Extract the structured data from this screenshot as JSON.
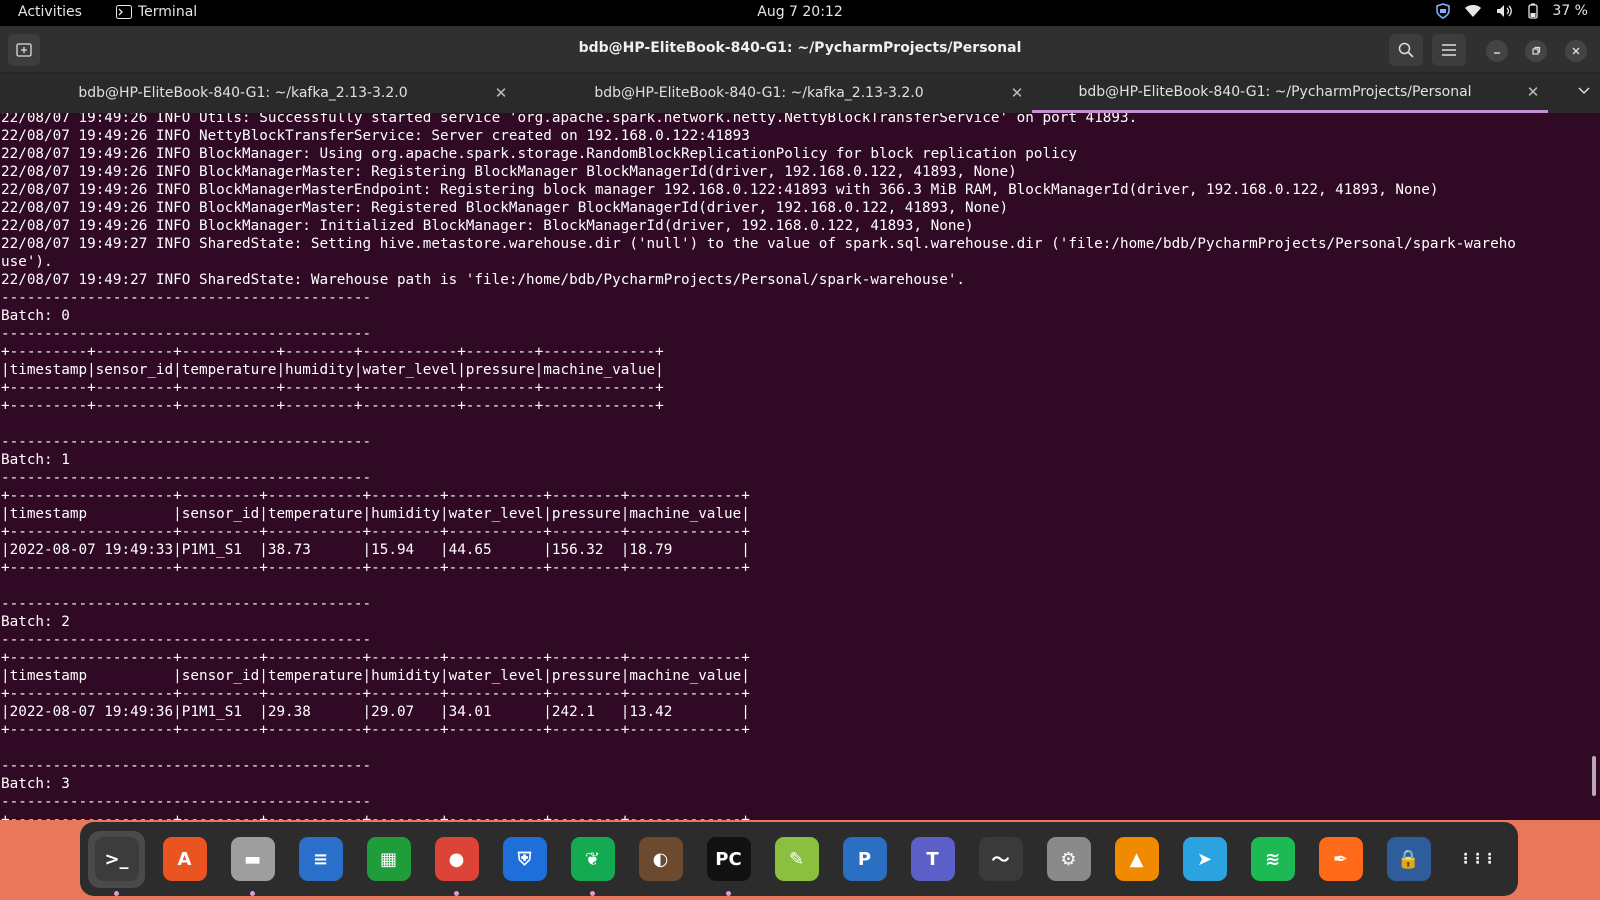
{
  "topbar": {
    "activities": "Activities",
    "app_name": "Terminal",
    "clock": "Aug 7  20:12",
    "battery": "37 %"
  },
  "window": {
    "title": "bdb@HP-EliteBook-840-G1: ~/PycharmProjects/Personal"
  },
  "tabs": [
    {
      "label": "bdb@HP-EliteBook-840-G1: ~/kafka_2.13-3.2.0"
    },
    {
      "label": "bdb@HP-EliteBook-840-G1: ~/kafka_2.13-3.2.0"
    },
    {
      "label": "bdb@HP-EliteBook-840-G1: ~/PycharmProjects/Personal"
    }
  ],
  "terminal": {
    "output": "22/08/07 19:49:26 INFO Utils: Successfully started service 'org.apache.spark.network.netty.NettyBlockTransferService' on port 41893.\n22/08/07 19:49:26 INFO NettyBlockTransferService: Server created on 192.168.0.122:41893\n22/08/07 19:49:26 INFO BlockManager: Using org.apache.spark.storage.RandomBlockReplicationPolicy for block replication policy\n22/08/07 19:49:26 INFO BlockManagerMaster: Registering BlockManager BlockManagerId(driver, 192.168.0.122, 41893, None)\n22/08/07 19:49:26 INFO BlockManagerMasterEndpoint: Registering block manager 192.168.0.122:41893 with 366.3 MiB RAM, BlockManagerId(driver, 192.168.0.122, 41893, None)\n22/08/07 19:49:26 INFO BlockManagerMaster: Registered BlockManager BlockManagerId(driver, 192.168.0.122, 41893, None)\n22/08/07 19:49:26 INFO BlockManager: Initialized BlockManager: BlockManagerId(driver, 192.168.0.122, 41893, None)\n22/08/07 19:49:27 INFO SharedState: Setting hive.metastore.warehouse.dir ('null') to the value of spark.sql.warehouse.dir ('file:/home/bdb/PycharmProjects/Personal/spark-wareho\nuse').\n22/08/07 19:49:27 INFO SharedState: Warehouse path is 'file:/home/bdb/PycharmProjects/Personal/spark-warehouse'.\n-------------------------------------------\nBatch: 0\n-------------------------------------------\n+---------+---------+-----------+--------+-----------+--------+-------------+\n|timestamp|sensor_id|temperature|humidity|water_level|pressure|machine_value|\n+---------+---------+-----------+--------+-----------+--------+-------------+\n+---------+---------+-----------+--------+-----------+--------+-------------+\n\n-------------------------------------------\nBatch: 1\n-------------------------------------------\n+-------------------+---------+-----------+--------+-----------+--------+-------------+\n|timestamp          |sensor_id|temperature|humidity|water_level|pressure|machine_value|\n+-------------------+---------+-----------+--------+-----------+--------+-------------+\n|2022-08-07 19:49:33|P1M1_S1  |38.73      |15.94   |44.65      |156.32  |18.79        |\n+-------------------+---------+-----------+--------+-----------+--------+-------------+\n\n-------------------------------------------\nBatch: 2\n-------------------------------------------\n+-------------------+---------+-----------+--------+-----------+--------+-------------+\n|timestamp          |sensor_id|temperature|humidity|water_level|pressure|machine_value|\n+-------------------+---------+-----------+--------+-----------+--------+-------------+\n|2022-08-07 19:49:36|P1M1_S1  |29.38      |29.07   |34.01      |242.1   |13.42        |\n+-------------------+---------+-----------+--------+-----------+--------+-------------+\n\n-------------------------------------------\nBatch: 3\n-------------------------------------------\n+-------------------+---------+-----------+--------+-----------+--------+-------------+"
  },
  "dock": {
    "items": [
      {
        "icon": "terminal-icon",
        "glyph": ">_",
        "bg": "#3c3c3c",
        "running": true,
        "active": true
      },
      {
        "icon": "app-center-icon",
        "glyph": "A",
        "bg": "#e95420",
        "running": false
      },
      {
        "icon": "files-icon",
        "glyph": "▬",
        "bg": "#9e9e9e",
        "running": true
      },
      {
        "icon": "writer-icon",
        "glyph": "≡",
        "bg": "#2a6fc9",
        "running": false
      },
      {
        "icon": "calc-icon",
        "glyph": "▦",
        "bg": "#1f9d3a",
        "running": false
      },
      {
        "icon": "chrome-icon",
        "glyph": "●",
        "bg": "#db4437",
        "running": true
      },
      {
        "icon": "shield-vpn-icon",
        "glyph": "⛨",
        "bg": "#1e6fd9",
        "running": false
      },
      {
        "icon": "mongodb-compass-icon",
        "glyph": "❦",
        "bg": "#13aa52",
        "running": true
      },
      {
        "icon": "dbeaver-icon",
        "glyph": "◐",
        "bg": "#6b4a2f",
        "running": false
      },
      {
        "icon": "pycharm-icon",
        "glyph": "PC",
        "bg": "#111111",
        "running": true
      },
      {
        "icon": "notes-icon",
        "glyph": "✎",
        "bg": "#8bbf3f",
        "running": false
      },
      {
        "icon": "pgadmin-icon",
        "glyph": "P",
        "bg": "#2b6fc2",
        "running": false
      },
      {
        "icon": "teams-icon",
        "glyph": "T",
        "bg": "#5b5fc7",
        "running": false
      },
      {
        "icon": "system-monitor-icon",
        "glyph": "〜",
        "bg": "#3a3a3a",
        "running": false
      },
      {
        "icon": "settings-icon",
        "glyph": "⚙",
        "bg": "#8a8a8a",
        "running": false
      },
      {
        "icon": "vlc-icon",
        "glyph": "▲",
        "bg": "#f08a00",
        "running": false
      },
      {
        "icon": "telegram-icon",
        "glyph": "➤",
        "bg": "#2aa3e0",
        "running": false
      },
      {
        "icon": "spotify-icon",
        "glyph": "≋",
        "bg": "#1db954",
        "running": false
      },
      {
        "icon": "pen-tool-icon",
        "glyph": "✒",
        "bg": "#ff6a1a",
        "running": false
      },
      {
        "icon": "lock-share-icon",
        "glyph": "🔒",
        "bg": "#2f5d9c",
        "running": false
      },
      {
        "icon": "app-grid-icon",
        "glyph": "⋮⋮⋮",
        "bg": "transparent",
        "running": false
      }
    ]
  },
  "colors": {
    "terminal_bg": "#300a24",
    "accent": "#c78ed6",
    "desktop": "#e9785a"
  }
}
